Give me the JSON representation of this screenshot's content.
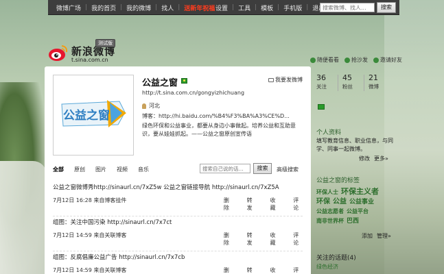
{
  "topbar": {
    "nav_left": [
      "微博广场",
      "我的首页",
      "我的微博",
      "找人",
      "送新年祝福"
    ],
    "nav_right": [
      "设置",
      "工具",
      "模板",
      "手机版",
      "退出"
    ],
    "search_placeholder": "搜索微博、找人...",
    "search_button": "搜索"
  },
  "logo": {
    "text": "新浪微博",
    "url": "t.sina.com.cn",
    "badge": "测试版"
  },
  "quick_links": [
    "随便看看",
    "抢沙发",
    "邀请好友"
  ],
  "profile": {
    "name": "公益之窗",
    "url": "http://t.sina.com.cn/gongyizhichuang",
    "complain": "我要发微博",
    "location": "河北",
    "blog": "博客：http://hi.baidu.com/%B4%F3%BA%A3%CE%D...",
    "description": "绿色环保和公益事业，都要从身边小事做起。培养公益和互助意识，要从娃娃抓起。——公益之窗原创宣传语",
    "avatar_text": "公益之窗"
  },
  "tabs": [
    "全部",
    "原创",
    "图片",
    "视频",
    "音乐"
  ],
  "feed_search": {
    "placeholder": "搜索自己说的话...",
    "button": "搜索",
    "advanced": "高级搜索"
  },
  "actions": [
    "删除",
    "转发",
    "收藏",
    "评论"
  ],
  "posts": [
    {
      "text": "公益之窗微博秀http://sinaurl.cn/7xZ5w 公益之窗链接导航  http://sinaurl.cn/7xZ5A",
      "time": "7月12日  16:28  来自博客挂件"
    },
    {
      "text": "组图：关注中国污染  http://sinaurl.cn/7x7ct",
      "time": "7月12日  14:59  来自关联博客"
    },
    {
      "text": "组图：反腐倡廉公益广告  http://sinaurl.cn/7x7cb",
      "time": "7月12日  14:59  来自关联博客"
    }
  ],
  "stats": [
    {
      "num": "36",
      "label": "关注"
    },
    {
      "num": "45",
      "label": "粉丝"
    },
    {
      "num": "21",
      "label": "微博"
    }
  ],
  "sidebar": {
    "profile_head": "个人资料",
    "profile_text": "填写教育信息、职业信息，与同学、同事一起微博。",
    "profile_links": [
      "修改",
      "更多»"
    ],
    "tags_head": "公益之窗的标签",
    "tags": [
      "环保人士",
      "环保主义者",
      "环保",
      "公益",
      "公益事业",
      "公益志愿者",
      "公益平台",
      "南非世界杯",
      "巴西"
    ],
    "tag_links": [
      "添加",
      "管理»"
    ],
    "topics_head": "关注的话题(4)",
    "topics": [
      "绿色经济"
    ]
  }
}
